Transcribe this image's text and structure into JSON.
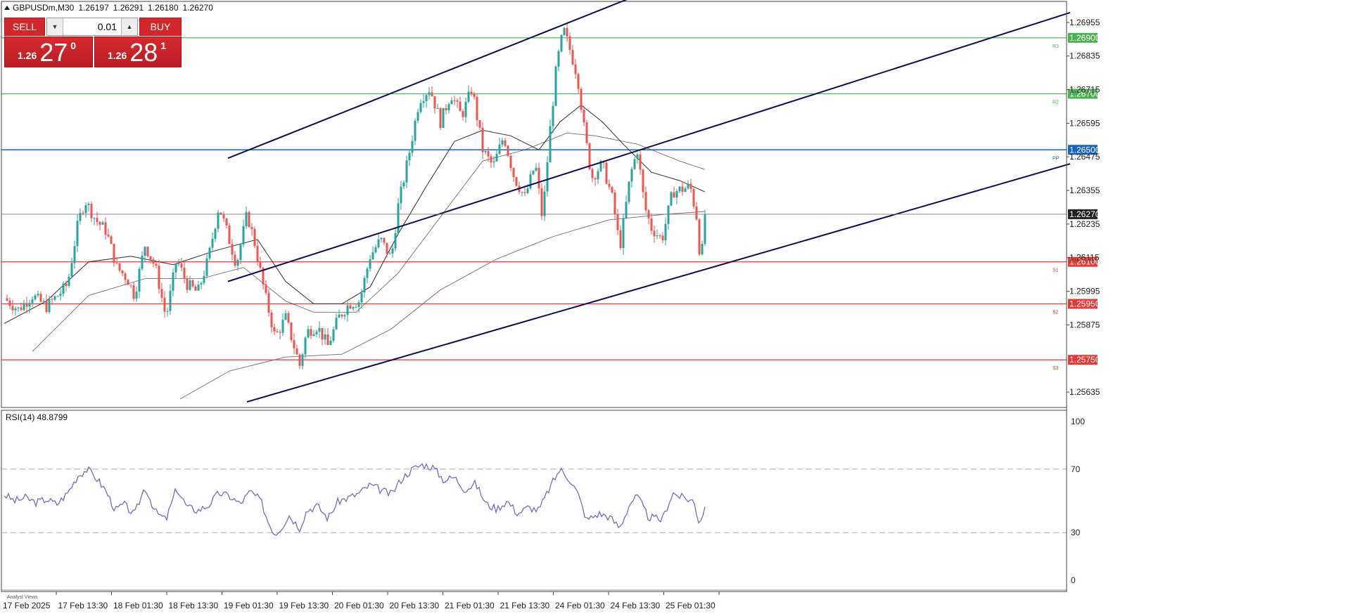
{
  "header": {
    "symbol_label": "GBPUSDm,M30",
    "ohlc": [
      "1.26197",
      "1.26291",
      "1.26180",
      "1.26270"
    ]
  },
  "trade_panel": {
    "sell_label": "SELL",
    "buy_label": "BUY",
    "lot_value": "0.01",
    "bid": {
      "prefix": "1.26",
      "big": "27",
      "small": "0"
    },
    "ask": {
      "prefix": "1.26",
      "big": "28",
      "small": "1"
    }
  },
  "colors": {
    "bull": "#26a69a",
    "bear": "#ef5350",
    "resistance": "#4caf50",
    "support": "#e53935",
    "pivot": "#1565c0",
    "channel": "#0d0d4f",
    "rsi": "#7b68c8",
    "ma_fast": "#3a2a2a",
    "ma_slow": "#8a6f86"
  },
  "chart_data": [
    {
      "type": "candlestick",
      "symbol": "GBPUSDm",
      "timeframe": "M30",
      "ylim": [
        1.2558,
        1.2703
      ],
      "y_ticks": [
        "1.26955",
        "1.26835",
        "1.26715",
        "1.26595",
        "1.26475",
        "1.26355",
        "1.26235",
        "1.26115",
        "1.25995",
        "1.25875",
        "1.25635"
      ],
      "x_ticks": [
        "17 Feb 2025",
        "17 Feb 13:30",
        "18 Feb 01:30",
        "18 Feb 13:30",
        "19 Feb 01:30",
        "19 Feb 13:30",
        "20 Feb 01:30",
        "20 Feb 13:30",
        "21 Feb 01:30",
        "21 Feb 13:30",
        "24 Feb 01:30",
        "24 Feb 13:30",
        "25 Feb 01:30"
      ],
      "current_price": "1.26270",
      "levels": [
        {
          "value": 1.269,
          "label": "1.26900",
          "tag": "R3",
          "kind": "resistance"
        },
        {
          "value": 1.267,
          "label": "1.26700",
          "tag": "R2",
          "kind": "resistance"
        },
        {
          "value": 1.265,
          "label": "1.26500",
          "tag": "PP",
          "kind": "pivot"
        },
        {
          "value": 1.261,
          "label": "1.26100",
          "tag": "S1",
          "kind": "support"
        },
        {
          "value": 1.2595,
          "label": "1.25950",
          "tag": "S2",
          "kind": "support"
        },
        {
          "value": 1.2575,
          "label": "1.25750",
          "tag": "S3",
          "kind": "support"
        }
      ],
      "close_path": [
        [
          0,
          1.2597
        ],
        [
          20,
          1.2593
        ],
        [
          40,
          1.2598
        ],
        [
          60,
          1.2594
        ],
        [
          80,
          1.2599
        ],
        [
          90,
          1.2602
        ],
        [
          105,
          1.2624
        ],
        [
          115,
          1.2632
        ],
        [
          130,
          1.2625
        ],
        [
          145,
          1.2621
        ],
        [
          160,
          1.2608
        ],
        [
          175,
          1.2604
        ],
        [
          185,
          1.2598
        ],
        [
          200,
          1.2616
        ],
        [
          215,
          1.2608
        ],
        [
          230,
          1.259
        ],
        [
          245,
          1.2611
        ],
        [
          260,
          1.2602
        ],
        [
          275,
          1.2599
        ],
        [
          290,
          1.2611
        ],
        [
          305,
          1.263
        ],
        [
          315,
          1.2622
        ],
        [
          330,
          1.2609
        ],
        [
          345,
          1.2627
        ],
        [
          355,
          1.2618
        ],
        [
          370,
          1.2599
        ],
        [
          385,
          1.2583
        ],
        [
          400,
          1.259
        ],
        [
          420,
          1.2573
        ],
        [
          430,
          1.2585
        ],
        [
          445,
          1.2587
        ],
        [
          460,
          1.258
        ],
        [
          475,
          1.259
        ],
        [
          490,
          1.2595
        ],
        [
          505,
          1.2596
        ],
        [
          520,
          1.2612
        ],
        [
          535,
          1.2618
        ],
        [
          550,
          1.2611
        ],
        [
          560,
          1.263
        ],
        [
          575,
          1.2648
        ],
        [
          590,
          1.2668
        ],
        [
          605,
          1.2672
        ],
        [
          620,
          1.266
        ],
        [
          635,
          1.267
        ],
        [
          650,
          1.2662
        ],
        [
          665,
          1.2672
        ],
        [
          680,
          1.265
        ],
        [
          695,
          1.2644
        ],
        [
          710,
          1.2655
        ],
        [
          725,
          1.264
        ],
        [
          740,
          1.2633
        ],
        [
          755,
          1.2645
        ],
        [
          765,
          1.2625
        ],
        [
          775,
          1.2655
        ],
        [
          785,
          1.268
        ],
        [
          795,
          1.2693
        ],
        [
          805,
          1.2685
        ],
        [
          815,
          1.2676
        ],
        [
          825,
          1.2656
        ],
        [
          835,
          1.264
        ],
        [
          850,
          1.2645
        ],
        [
          865,
          1.2632
        ],
        [
          875,
          1.2615
        ],
        [
          890,
          1.2641
        ],
        [
          900,
          1.265
        ],
        [
          910,
          1.263
        ],
        [
          920,
          1.2622
        ],
        [
          935,
          1.2618
        ],
        [
          950,
          1.2635
        ],
        [
          965,
          1.2636
        ],
        [
          975,
          1.2637
        ],
        [
          985,
          1.2625
        ],
        [
          990,
          1.2608
        ],
        [
          996,
          1.2627
        ]
      ],
      "ma_fast": [
        [
          0,
          1.2588
        ],
        [
          60,
          1.2596
        ],
        [
          120,
          1.261
        ],
        [
          180,
          1.2612
        ],
        [
          240,
          1.2609
        ],
        [
          300,
          1.2614
        ],
        [
          360,
          1.2618
        ],
        [
          400,
          1.2603
        ],
        [
          440,
          1.2595
        ],
        [
          480,
          1.2595
        ],
        [
          520,
          1.2601
        ],
        [
          560,
          1.262
        ],
        [
          600,
          1.2637
        ],
        [
          640,
          1.2653
        ],
        [
          680,
          1.2657
        ],
        [
          720,
          1.2655
        ],
        [
          760,
          1.265
        ],
        [
          790,
          1.266
        ],
        [
          820,
          1.2666
        ],
        [
          850,
          1.266
        ],
        [
          880,
          1.2652
        ],
        [
          920,
          1.2642
        ],
        [
          960,
          1.2639
        ],
        [
          996,
          1.2635
        ]
      ],
      "ma_slow": [
        [
          40,
          1.2578
        ],
        [
          120,
          1.2598
        ],
        [
          200,
          1.2604
        ],
        [
          280,
          1.2604
        ],
        [
          340,
          1.2608
        ],
        [
          400,
          1.2596
        ],
        [
          440,
          1.2592
        ],
        [
          500,
          1.2592
        ],
        [
          560,
          1.2606
        ],
        [
          620,
          1.2626
        ],
        [
          680,
          1.2646
        ],
        [
          740,
          1.265
        ],
        [
          800,
          1.2656
        ],
        [
          840,
          1.2655
        ],
        [
          900,
          1.2652
        ],
        [
          960,
          1.2646
        ],
        [
          996,
          1.2643
        ]
      ],
      "ma_long": [
        [
          250,
          1.2561
        ],
        [
          320,
          1.2571
        ],
        [
          400,
          1.2576
        ],
        [
          480,
          1.2577
        ],
        [
          550,
          1.2586
        ],
        [
          620,
          1.26
        ],
        [
          700,
          1.2611
        ],
        [
          780,
          1.2619
        ],
        [
          860,
          1.2625
        ],
        [
          940,
          1.2627
        ],
        [
          996,
          1.2628
        ]
      ],
      "channel_lines": [
        {
          "from": [
            318,
            1.2647
          ],
          "to": [
            948,
            1.271
          ]
        },
        {
          "from": [
            318,
            1.2603
          ],
          "to": [
            1515,
            1.2699
          ]
        },
        {
          "from": [
            345,
            1.256
          ],
          "to": [
            1515,
            1.2645
          ]
        }
      ]
    },
    {
      "type": "line",
      "title": "RSI(14) 48.8799",
      "ylim": [
        0,
        100
      ],
      "y_ticks": [
        "100",
        "70",
        "30",
        "0"
      ],
      "levels": [
        70,
        30
      ],
      "values": [
        [
          0,
          54
        ],
        [
          15,
          50
        ],
        [
          30,
          52
        ],
        [
          45,
          49
        ],
        [
          60,
          51
        ],
        [
          75,
          48
        ],
        [
          90,
          55
        ],
        [
          105,
          66
        ],
        [
          118,
          70
        ],
        [
          130,
          65
        ],
        [
          145,
          56
        ],
        [
          158,
          44
        ],
        [
          170,
          48
        ],
        [
          185,
          41
        ],
        [
          200,
          59
        ],
        [
          215,
          43
        ],
        [
          230,
          38
        ],
        [
          245,
          58
        ],
        [
          260,
          46
        ],
        [
          275,
          44
        ],
        [
          290,
          47
        ],
        [
          305,
          55
        ],
        [
          320,
          53
        ],
        [
          335,
          48
        ],
        [
          350,
          56
        ],
        [
          365,
          50
        ],
        [
          375,
          37
        ],
        [
          385,
          29
        ],
        [
          395,
          34
        ],
        [
          405,
          41
        ],
        [
          420,
          33
        ],
        [
          430,
          44
        ],
        [
          445,
          47
        ],
        [
          460,
          39
        ],
        [
          475,
          50
        ],
        [
          490,
          52
        ],
        [
          505,
          55
        ],
        [
          520,
          60
        ],
        [
          535,
          57
        ],
        [
          550,
          54
        ],
        [
          565,
          64
        ],
        [
          580,
          70
        ],
        [
          595,
          73
        ],
        [
          610,
          71
        ],
        [
          625,
          63
        ],
        [
          640,
          65
        ],
        [
          655,
          57
        ],
        [
          670,
          61
        ],
        [
          685,
          48
        ],
        [
          700,
          45
        ],
        [
          715,
          50
        ],
        [
          730,
          42
        ],
        [
          745,
          46
        ],
        [
          760,
          44
        ],
        [
          775,
          58
        ],
        [
          790,
          70
        ],
        [
          805,
          63
        ],
        [
          815,
          55
        ],
        [
          828,
          38
        ],
        [
          845,
          42
        ],
        [
          860,
          40
        ],
        [
          875,
          33
        ],
        [
          890,
          49
        ],
        [
          900,
          53
        ],
        [
          915,
          40
        ],
        [
          935,
          38
        ],
        [
          950,
          55
        ],
        [
          965,
          52
        ],
        [
          980,
          50
        ],
        [
          988,
          36
        ],
        [
          996,
          46
        ]
      ]
    }
  ]
}
